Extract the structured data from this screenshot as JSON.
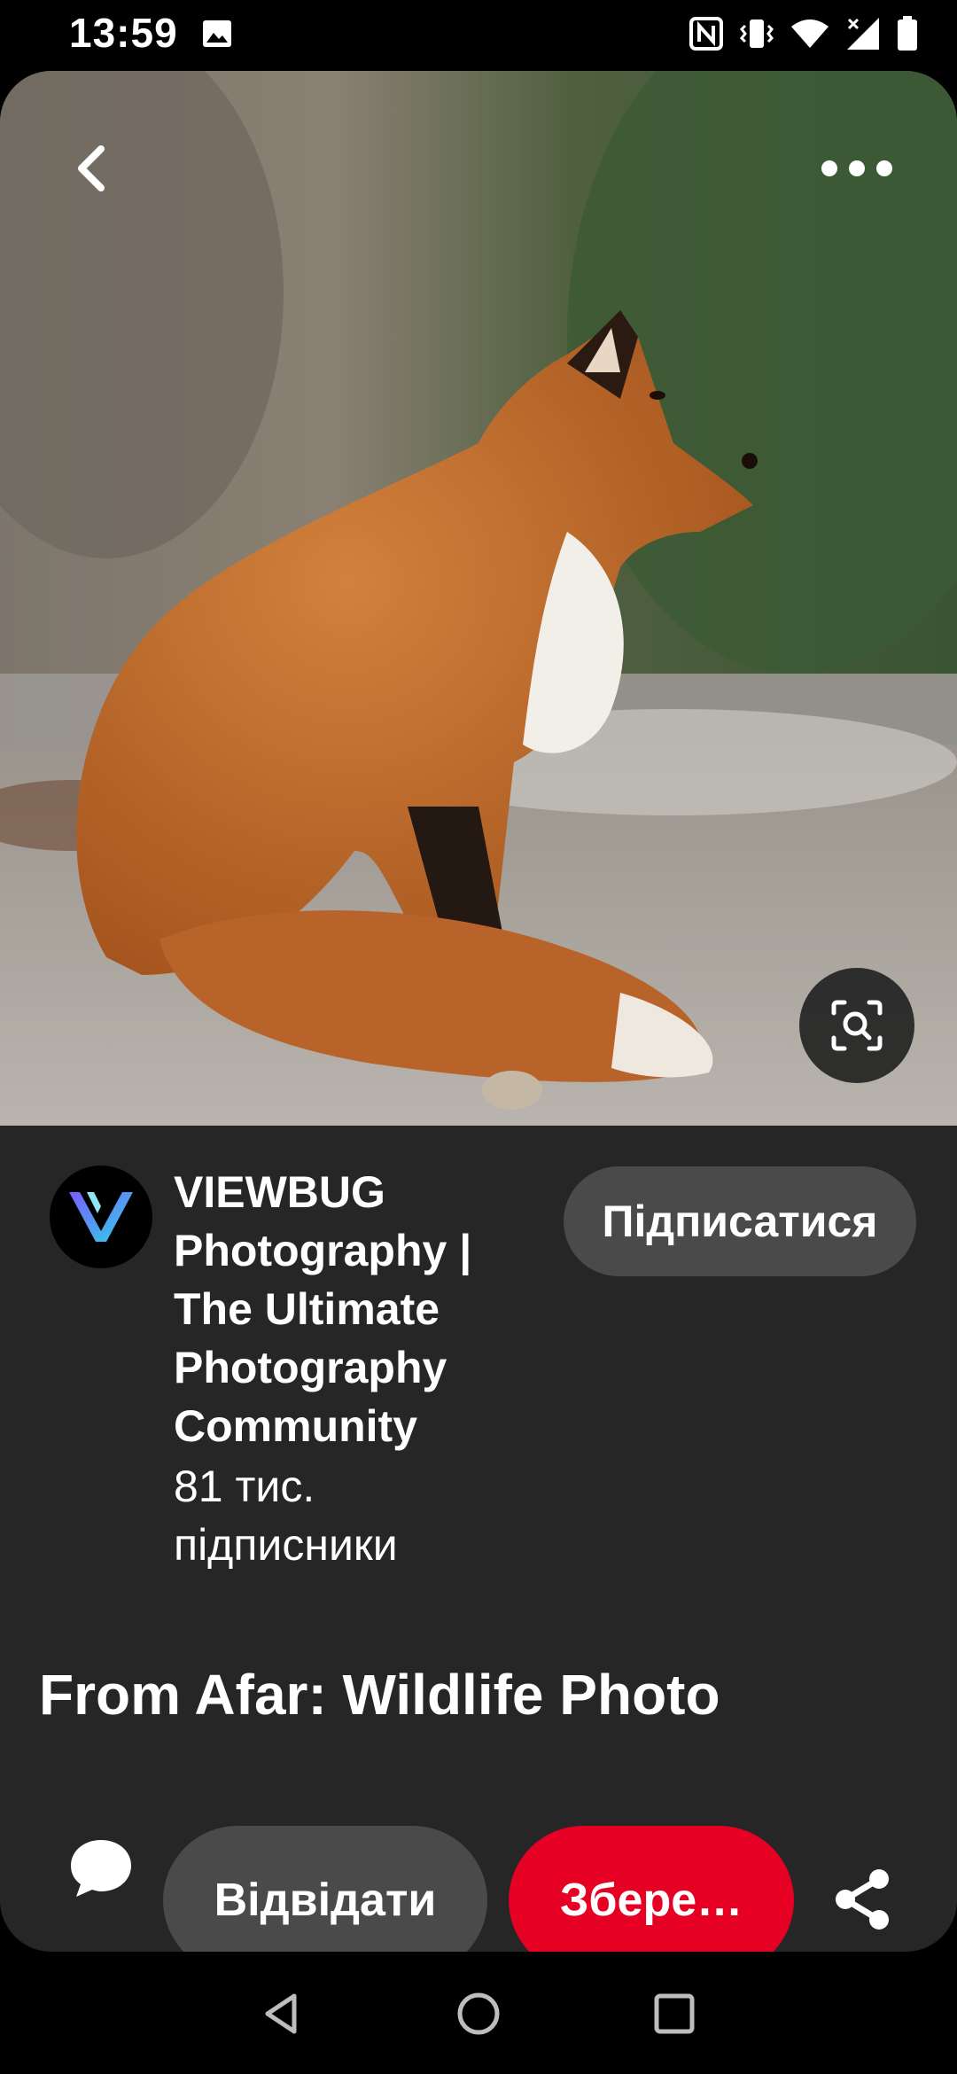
{
  "status_bar": {
    "time": "13:59",
    "icons": [
      "gallery-icon",
      "nfc-icon",
      "vibrate-icon",
      "wifi-icon",
      "signal-icon",
      "battery-icon"
    ]
  },
  "pin": {
    "image_description_icon": "fox-photo",
    "top_controls": [
      "back-arrow-icon",
      "more-options-icon"
    ],
    "visual_search_icon": "visual-search-icon"
  },
  "creator": {
    "name": "VIEWBUG Photography | The Ultimate Photography Community",
    "followers": "81 тис. підписники",
    "follow_label": "Підписатися"
  },
  "title": "From Afar: Wildlife Photo",
  "actions": {
    "comment_icon": "comment-icon",
    "visit_label": "Відвідати",
    "save_label": "Збере…",
    "share_icon": "share-icon"
  },
  "colors": {
    "card_background": "#262626",
    "save_button": "#e60023",
    "secondary_button": "#4a4a4a"
  },
  "nav_bar": [
    "nav-back-icon",
    "nav-home-icon",
    "nav-recents-icon"
  ]
}
